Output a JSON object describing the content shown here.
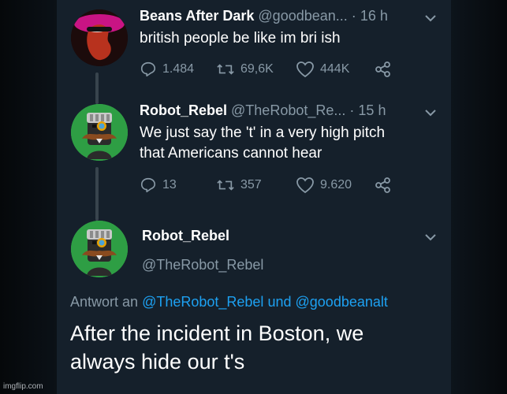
{
  "colors": {
    "background": "#15202b",
    "text": "#ffffff",
    "muted": "#8899a6",
    "link": "#1da1f2",
    "thread_line": "#38444d",
    "avatar_green": "#2e9e44"
  },
  "tweets": [
    {
      "display_name": "Beans After Dark",
      "handle": "@goodbean...",
      "dot": "·",
      "time": "16 h",
      "text": "british people be like im bri ish",
      "reply_count": "1.484",
      "retweet_count": "69,6K",
      "like_count": "444K"
    },
    {
      "display_name": "Robot_Rebel",
      "handle": "@TheRobot_Re...",
      "dot": "·",
      "time": "15 h",
      "text_line1": "We just say the 't' in a very high pitch",
      "text_line2": "that Americans cannot hear",
      "reply_count": "13",
      "retweet_count": "357",
      "like_count": "9.620"
    }
  ],
  "main_tweet": {
    "display_name": "Robot_Rebel",
    "handle": "@TheRobot_Rebel",
    "reply_prefix": "Antwort an",
    "reply_to_1": "@TheRobot_Rebel",
    "reply_and": "und",
    "reply_to_2": "@goodbeanalt",
    "text_line1": "After the incident in Boston, we",
    "text_line2": "always hide our t's"
  },
  "icons": {
    "reply": "reply-icon",
    "retweet": "retweet-icon",
    "like": "heart-icon",
    "share": "share-icon",
    "menu": "chevron-down-icon"
  },
  "watermark": "imgflip.com"
}
